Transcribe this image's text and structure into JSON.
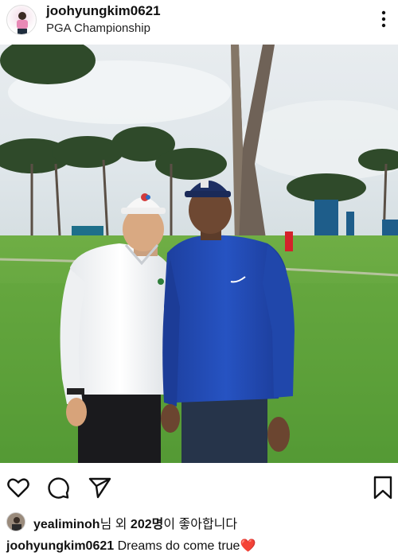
{
  "post": {
    "username": "joohyungkim0621",
    "location": "PGA Championship",
    "photo_alt": ""
  },
  "icons": {
    "more": "more-vertical-icon",
    "like": "heart-outline-icon",
    "comment": "comment-icon",
    "share": "send-icon",
    "save": "bookmark-icon"
  },
  "likes": {
    "liker_name": "yealiminoh",
    "text_mid": "님 외 ",
    "count": "202명",
    "text_end": "이 좋아합니다"
  },
  "caption": {
    "username": "joohyungkim0621",
    "text": " Dreams do come true",
    "emoji": "❤️"
  },
  "colors": {
    "accent_heart": "#e0121a",
    "text": "#111111"
  }
}
